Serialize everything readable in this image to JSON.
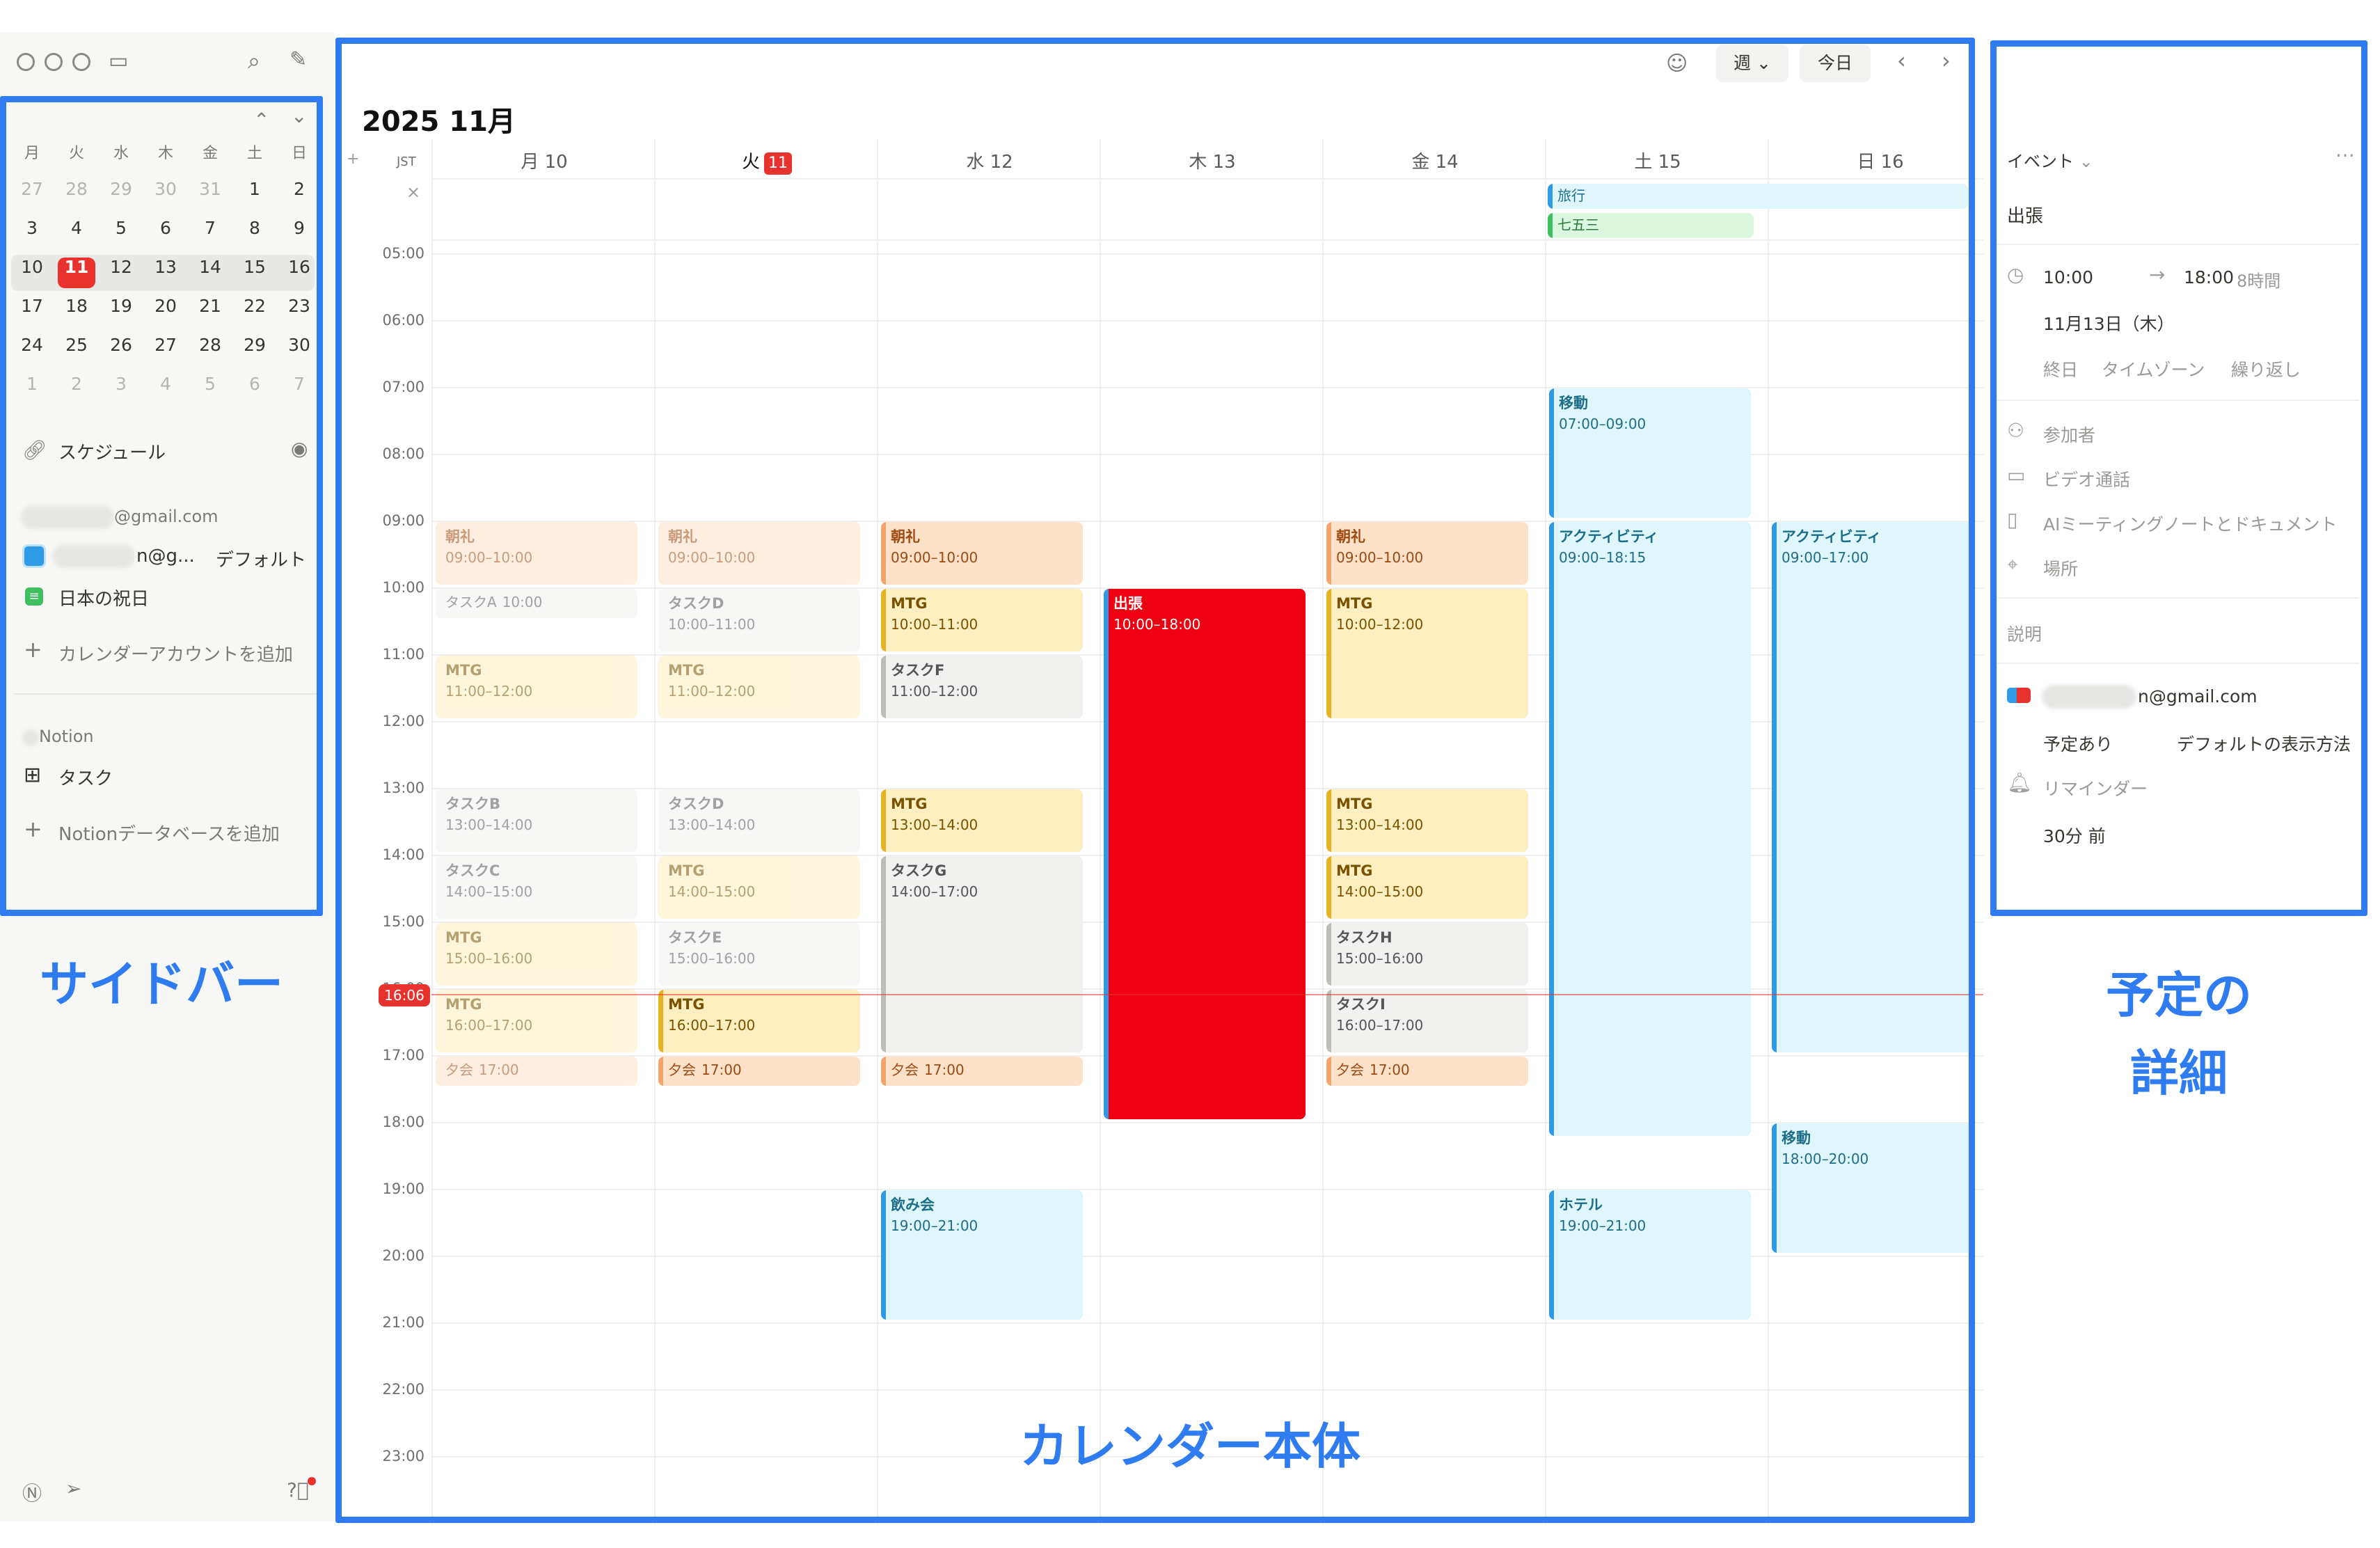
{
  "annotations": {
    "sidebar": "サイドバー",
    "calendar": "カレンダー本体",
    "details_line1": "予定の",
    "details_line2": "詳細"
  },
  "sidebar": {
    "mini_cal": {
      "weekdays": [
        "月",
        "火",
        "水",
        "木",
        "金",
        "土",
        "日"
      ],
      "weeks": [
        [
          "27",
          "28",
          "29",
          "30",
          "31",
          "1",
          "2"
        ],
        [
          "3",
          "4",
          "5",
          "6",
          "7",
          "8",
          "9"
        ],
        [
          "10",
          "11",
          "12",
          "13",
          "14",
          "15",
          "16"
        ],
        [
          "17",
          "18",
          "19",
          "20",
          "21",
          "22",
          "23"
        ],
        [
          "24",
          "25",
          "26",
          "27",
          "28",
          "29",
          "30"
        ],
        [
          "1",
          "2",
          "3",
          "4",
          "5",
          "6",
          "7"
        ]
      ],
      "today": "11"
    },
    "schedule_label": "スケジュール",
    "account_email": "@gmail.com",
    "default_cal": "n@g...",
    "default_tag": "デフォルト",
    "holiday_cal": "日本の祝日",
    "add_calendar_account": "カレンダーアカウントを追加",
    "notion_label": "Notion",
    "tasks_db": "タスク",
    "add_notion_db": "Notionデータベースを追加"
  },
  "calendar": {
    "title": "2025 11月",
    "timezone": "JST",
    "view_label": "週",
    "today_button": "今日",
    "days": [
      "月 10",
      "火",
      "水 12",
      "木 13",
      "金 14",
      "土 15",
      "日 16"
    ],
    "today_num": "11",
    "hours": [
      "05:00",
      "06:00",
      "07:00",
      "08:00",
      "09:00",
      "10:00",
      "11:00",
      "12:00",
      "13:00",
      "14:00",
      "15:00",
      "16:00",
      "17:00",
      "18:00",
      "19:00",
      "20:00",
      "21:00",
      "22:00",
      "23:00"
    ],
    "now": "16:06",
    "allday": [
      {
        "title": "旅行",
        "color": "cyan"
      },
      {
        "title": "七五三",
        "color": "green"
      }
    ],
    "events": [
      {
        "day": 0,
        "title": "朝礼",
        "time": "09:00–10:00",
        "color": "orange",
        "faded": true
      },
      {
        "day": 0,
        "title": "タスクA",
        "time": "10:00",
        "color": "gray",
        "faded": true
      },
      {
        "day": 0,
        "title": "MTG",
        "time": "11:00–12:00",
        "color": "yellow",
        "faded": true
      },
      {
        "day": 0,
        "title": "タスクB",
        "time": "13:00–14:00",
        "color": "gray",
        "faded": true
      },
      {
        "day": 0,
        "title": "タスクC",
        "time": "14:00–15:00",
        "color": "gray",
        "faded": true
      },
      {
        "day": 0,
        "title": "MTG",
        "time": "15:00–16:00",
        "color": "yellow",
        "faded": true
      },
      {
        "day": 0,
        "title": "MTG",
        "time": "16:00–17:00",
        "color": "yellow",
        "faded": true
      },
      {
        "day": 0,
        "title": "夕会",
        "time": "17:00",
        "color": "orange",
        "faded": true
      },
      {
        "day": 1,
        "title": "朝礼",
        "time": "09:00–10:00",
        "color": "orange",
        "faded": true
      },
      {
        "day": 1,
        "title": "タスクD",
        "time": "10:00–11:00",
        "color": "gray",
        "faded": true
      },
      {
        "day": 1,
        "title": "MTG",
        "time": "11:00–12:00",
        "color": "yellow",
        "faded": true
      },
      {
        "day": 1,
        "title": "タスクD",
        "time": "13:00–14:00",
        "color": "gray",
        "faded": true
      },
      {
        "day": 1,
        "title": "MTG",
        "time": "14:00–15:00",
        "color": "yellow",
        "faded": true
      },
      {
        "day": 1,
        "title": "タスクE",
        "time": "15:00–16:00",
        "color": "gray",
        "faded": true
      },
      {
        "day": 1,
        "title": "MTG",
        "time": "16:00–17:00",
        "color": "yellow",
        "faded": false
      },
      {
        "day": 1,
        "title": "夕会",
        "time": "17:00",
        "color": "orange",
        "faded": false
      },
      {
        "day": 2,
        "title": "朝礼",
        "time": "09:00–10:00",
        "color": "orange",
        "faded": false
      },
      {
        "day": 2,
        "title": "MTG",
        "time": "10:00–11:00",
        "color": "yellow",
        "faded": false
      },
      {
        "day": 2,
        "title": "タスクF",
        "time": "11:00–12:00",
        "color": "gray",
        "faded": false
      },
      {
        "day": 2,
        "title": "MTG",
        "time": "13:00–14:00",
        "color": "yellow",
        "faded": false
      },
      {
        "day": 2,
        "title": "タスクG",
        "time": "14:00–17:00",
        "color": "gray",
        "faded": false
      },
      {
        "day": 2,
        "title": "夕会",
        "time": "17:00",
        "color": "orange",
        "faded": false
      },
      {
        "day": 2,
        "title": "飲み会",
        "time": "19:00–21:00",
        "color": "cyan",
        "faded": false
      },
      {
        "day": 3,
        "title": "出張",
        "time": "10:00–18:00",
        "color": "red",
        "faded": false
      },
      {
        "day": 4,
        "title": "朝礼",
        "time": "09:00–10:00",
        "color": "orange",
        "faded": false
      },
      {
        "day": 4,
        "title": "MTG",
        "time": "10:00–12:00",
        "color": "yellow",
        "faded": false
      },
      {
        "day": 4,
        "title": "MTG",
        "time": "13:00–14:00",
        "color": "yellow",
        "faded": false
      },
      {
        "day": 4,
        "title": "MTG",
        "time": "14:00–15:00",
        "color": "yellow",
        "faded": false
      },
      {
        "day": 4,
        "title": "タスクH",
        "time": "15:00–16:00",
        "color": "gray",
        "faded": false
      },
      {
        "day": 4,
        "title": "タスクI",
        "time": "16:00–17:00",
        "color": "gray",
        "faded": false
      },
      {
        "day": 4,
        "title": "夕会",
        "time": "17:00",
        "color": "orange",
        "faded": false
      },
      {
        "day": 5,
        "title": "移動",
        "time": "07:00–09:00",
        "color": "cyan",
        "faded": false
      },
      {
        "day": 5,
        "title": "アクティビティ",
        "time": "09:00–18:15",
        "color": "cyan",
        "faded": false
      },
      {
        "day": 5,
        "title": "ホテル",
        "time": "19:00–21:00",
        "color": "cyan",
        "faded": false
      },
      {
        "day": 6,
        "title": "アクティビティ",
        "time": "09:00–17:00",
        "color": "cyan",
        "faded": false
      },
      {
        "day": 6,
        "title": "移動",
        "time": "18:00–20:00",
        "color": "cyan",
        "faded": false
      }
    ]
  },
  "details": {
    "type_label": "イベント",
    "event_title": "出張",
    "start_time": "10:00",
    "end_time": "18:00",
    "duration": "8時間",
    "date": "11月13日（木）",
    "all_day": "終日",
    "timezone": "タイムゾーン",
    "repeat": "繰り返し",
    "attendees": "参加者",
    "video_call": "ビデオ通話",
    "ai_notes": "AIミーティングノートとドキュメント",
    "location": "場所",
    "description": "説明",
    "calendar_email": "n@gmail.com",
    "busy": "予定あり",
    "visibility": "デフォルトの表示方法",
    "reminder": "リマインダー",
    "reminder_value": "30分 前"
  }
}
